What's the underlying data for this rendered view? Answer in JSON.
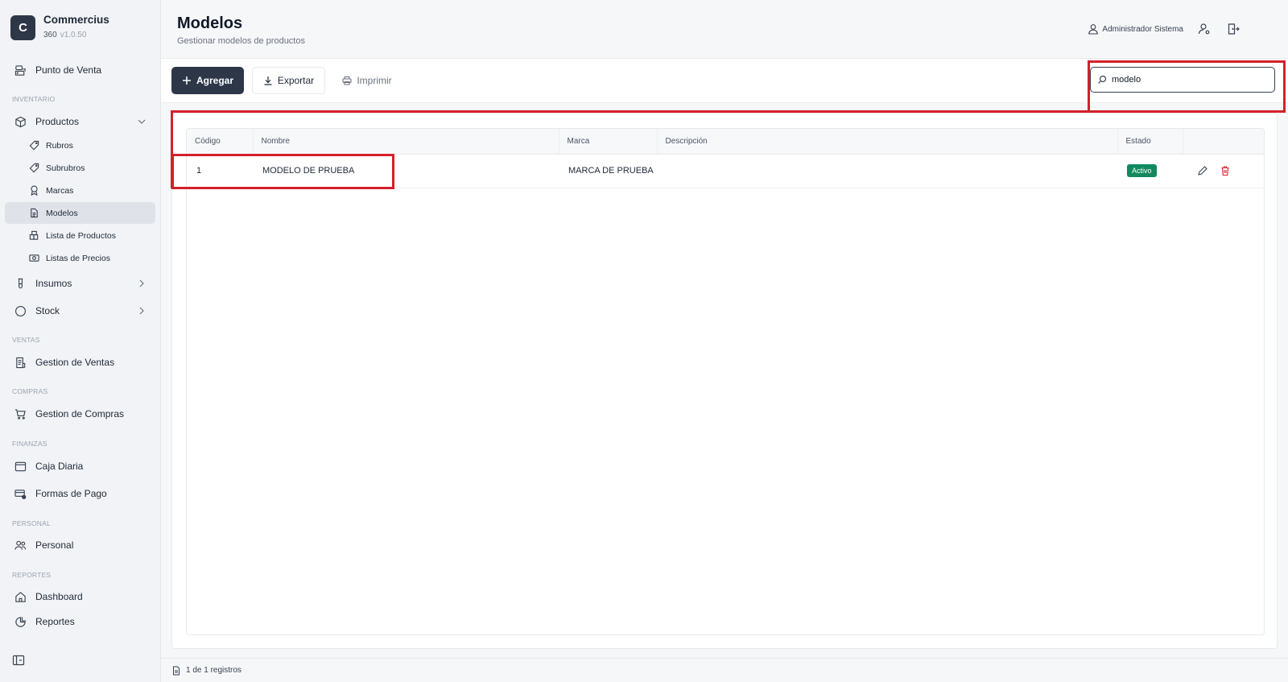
{
  "brand": {
    "logo_letter": "C",
    "name": "Commercius",
    "sub": "360",
    "version": "v1.0.50"
  },
  "sidebar": {
    "pos": "Punto de Venta",
    "sections": {
      "inventario": "INVENTARIO",
      "ventas": "VENTAS",
      "compras": "COMPRAS",
      "finanzas": "FINANZAS",
      "personal": "PERSONAL",
      "reportes": "REPORTES"
    },
    "productos": "Productos",
    "sub_items": {
      "rubros": "Rubros",
      "subrubros": "Subrubros",
      "marcas": "Marcas",
      "modelos": "Modelos",
      "lista_productos": "Lista de Productos",
      "listas_precios": "Listas de Precios"
    },
    "insumos": "Insumos",
    "stock": "Stock",
    "gestion_ventas": "Gestion de Ventas",
    "gestion_compras": "Gestion de Compras",
    "caja_diaria": "Caja Diaria",
    "formas_pago": "Formas de Pago",
    "personal": "Personal",
    "dashboard": "Dashboard",
    "reportes": "Reportes"
  },
  "header": {
    "title": "Modelos",
    "subtitle": "Gestionar modelos de productos",
    "user": "Administrador Sistema"
  },
  "toolbar": {
    "add": "Agregar",
    "export": "Exportar",
    "print": "Imprimir",
    "search_value": "modelo"
  },
  "table": {
    "columns": [
      "Código",
      "Nombre",
      "Marca",
      "Descripción",
      "Estado",
      ""
    ],
    "rows": [
      {
        "codigo": "1",
        "nombre": "MODELO DE PRUEBA",
        "marca": "MARCA DE PRUEBA",
        "descripcion": "",
        "estado": "Activo"
      }
    ]
  },
  "footer": {
    "records": "1 de 1 registros"
  },
  "colors": {
    "primary": "#2d3748",
    "success": "#0f8a5f",
    "danger": "#d4202c",
    "annotation": "#d4202c"
  }
}
